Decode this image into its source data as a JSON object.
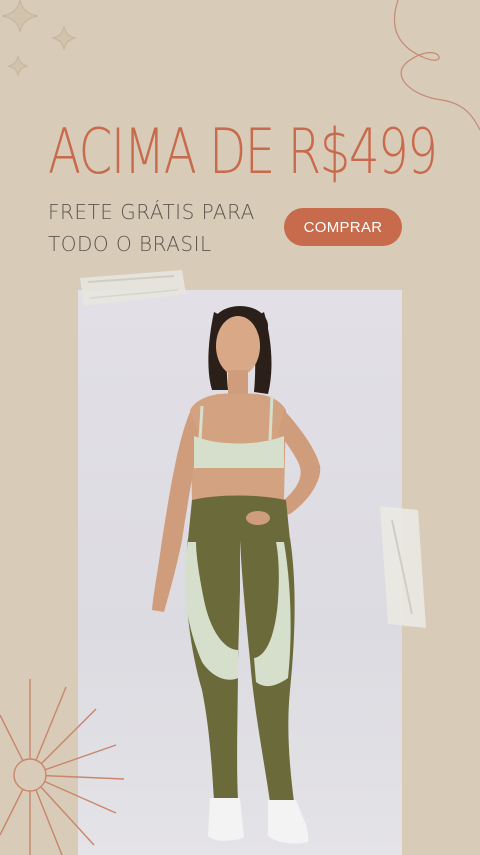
{
  "banner": {
    "headline": "ACIMA DE R$499",
    "subline": [
      "FRETE GRÁTIS PARA",
      "TODO O BRASIL"
    ],
    "cta_label": "COMPRAR"
  },
  "colors": {
    "background": "#d8cbb8",
    "accent": "#c86a4c",
    "text": "#5a5650",
    "leggings": "#6b6a3a",
    "top_and_panels": "#d6dfcb"
  },
  "decorations": [
    "sparkle-icon",
    "swirl-line",
    "sunburst-icon",
    "tape-strip"
  ]
}
